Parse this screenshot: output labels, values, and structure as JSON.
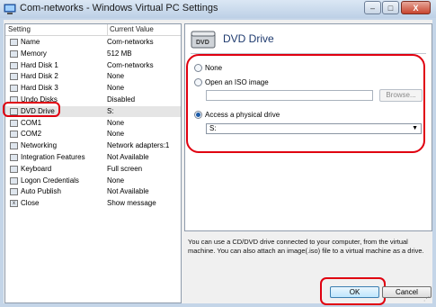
{
  "window": {
    "title": "Com-networks - Windows Virtual PC Settings",
    "minimize_glyph": "–",
    "maximize_glyph": "□",
    "close_glyph": "X"
  },
  "settings_list": {
    "col_setting": "Setting",
    "col_value": "Current Value",
    "rows": [
      {
        "name": "Name",
        "value": "Com-networks",
        "icon": "document-icon"
      },
      {
        "name": "Memory",
        "value": "512 MB",
        "icon": "memory-icon"
      },
      {
        "name": "Hard Disk 1",
        "value": "Com-networks",
        "icon": "hard-disk-icon"
      },
      {
        "name": "Hard Disk 2",
        "value": "None",
        "icon": "hard-disk-icon"
      },
      {
        "name": "Hard Disk 3",
        "value": "None",
        "icon": "hard-disk-icon"
      },
      {
        "name": "Undo Disks",
        "value": "Disabled",
        "icon": "undo-disk-icon"
      },
      {
        "name": "DVD Drive",
        "value": "S:",
        "icon": "dvd-drive-icon",
        "selected": true
      },
      {
        "name": "COM1",
        "value": "None",
        "icon": "com-port-icon"
      },
      {
        "name": "COM2",
        "value": "None",
        "icon": "com-port-icon"
      },
      {
        "name": "Networking",
        "value": "Network adapters:1",
        "icon": "network-icon"
      },
      {
        "name": "Integration Features",
        "value": "Not Available",
        "icon": "integration-icon"
      },
      {
        "name": "Keyboard",
        "value": "Full screen",
        "icon": "keyboard-icon"
      },
      {
        "name": "Logon Credentials",
        "value": "None",
        "icon": "key-icon"
      },
      {
        "name": "Auto Publish",
        "value": "Not Available",
        "icon": "auto-publish-icon"
      },
      {
        "name": "Close",
        "value": "Show message",
        "icon": "close-tool-icon"
      }
    ]
  },
  "dvd": {
    "title": "DVD Drive",
    "icon_text": "DVD",
    "opt_none": "None",
    "opt_iso": "Open an ISO image",
    "iso_value": "",
    "browse_label": "Browse...",
    "opt_physical": "Access a physical drive",
    "selected_option": "Access a physical drive",
    "drive_value": "S:",
    "dropdown_glyph": "▼"
  },
  "description": "You can use a CD/DVD drive connected to your computer, from the virtual machine. You can also attach an image(.iso) file to a virtual machine as a drive.",
  "buttons": {
    "ok": "OK",
    "cancel": "Cancel"
  },
  "colors": {
    "highlight": "#e00010",
    "title_accent": "#1e3a6e",
    "selection": "#e5e5e5"
  }
}
